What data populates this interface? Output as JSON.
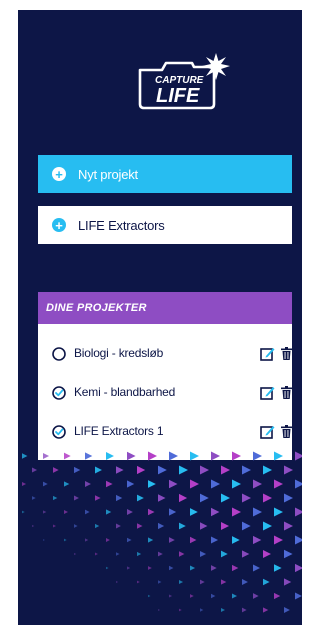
{
  "brand": {
    "logo_text_top": "CAPTURE",
    "logo_text_bottom": "LIFE"
  },
  "actions": {
    "new_project_label": "Nyt projekt",
    "extractors_label": "LIFE Extractors"
  },
  "projects": {
    "header": "DINE PROJEKTER",
    "items": [
      {
        "label": "Biologi - kredsløb",
        "status": "unchecked"
      },
      {
        "label": "Kemi - blandbarhed",
        "status": "checked"
      },
      {
        "label": "LIFE Extractors 1",
        "status": "checked"
      }
    ]
  },
  "colors": {
    "background": "#0d1647",
    "accent_blue": "#27bdf1",
    "accent_purple": "#8e4dc3",
    "text_dark": "#0d1647"
  },
  "icons": [
    "camera-logo-icon",
    "plus-circle-icon",
    "radio-unchecked-icon",
    "radio-checked-icon",
    "edit-icon",
    "trash-icon"
  ]
}
